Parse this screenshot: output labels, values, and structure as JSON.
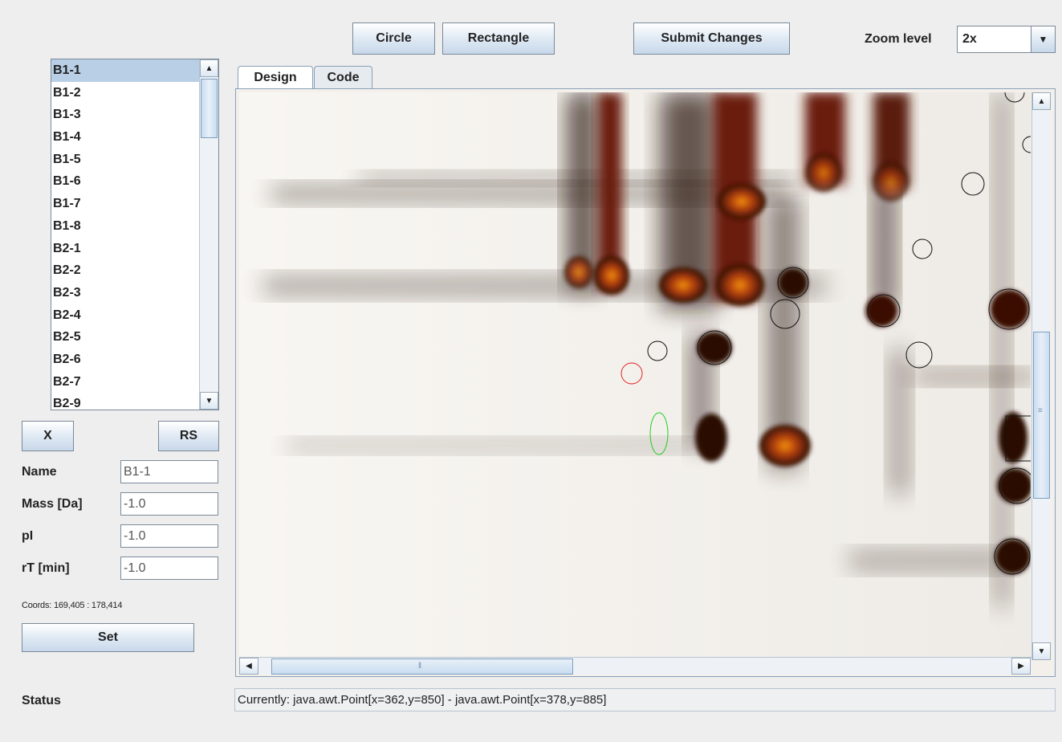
{
  "toolbar": {
    "circle_label": "Circle",
    "rectangle_label": "Rectangle",
    "submit_label": "Submit Changes",
    "zoom_label": "Zoom level",
    "zoom_value": "2x"
  },
  "spot_list": {
    "items": [
      "B1-1",
      "B1-2",
      "B1-3",
      "B1-4",
      "B1-5",
      "B1-6",
      "B1-7",
      "B1-8",
      "B2-1",
      "B2-2",
      "B2-3",
      "B2-4",
      "B2-5",
      "B2-6",
      "B2-7",
      "B2-9"
    ],
    "selected": "B1-1"
  },
  "actions": {
    "x_label": "X",
    "rs_label": "RS",
    "set_label": "Set"
  },
  "form": {
    "name_label": "Name",
    "name_value": "B1-1",
    "mass_label": "Mass [Da]",
    "mass_value": "-1.0",
    "pi_label": "pI",
    "pi_value": "-1.0",
    "rt_label": "rT [min]",
    "rt_value": "-1.0",
    "coords": "Coords: 169,405 : 178,414"
  },
  "tabs": [
    {
      "label": "Design"
    },
    {
      "label": "Code"
    }
  ],
  "active_tab": "Design",
  "status": {
    "label": "Status",
    "text": "Currently: java.awt.Point[x=362,y=850] - java.awt.Point[x=378,y=885]"
  },
  "colors": {
    "selection": "#b8cfe5",
    "spot_outline": "#111111",
    "selected_spot_outline": "#e02020",
    "new_spot_outline": "#22cc22",
    "gel_background": "#f3f0ec"
  },
  "icons": {
    "list_up": "triangle-up-icon",
    "list_down": "triangle-down-icon",
    "zoom_dropdown": "triangle-down-icon",
    "scroll_left": "triangle-left-icon",
    "scroll_right": "triangle-right-icon"
  }
}
